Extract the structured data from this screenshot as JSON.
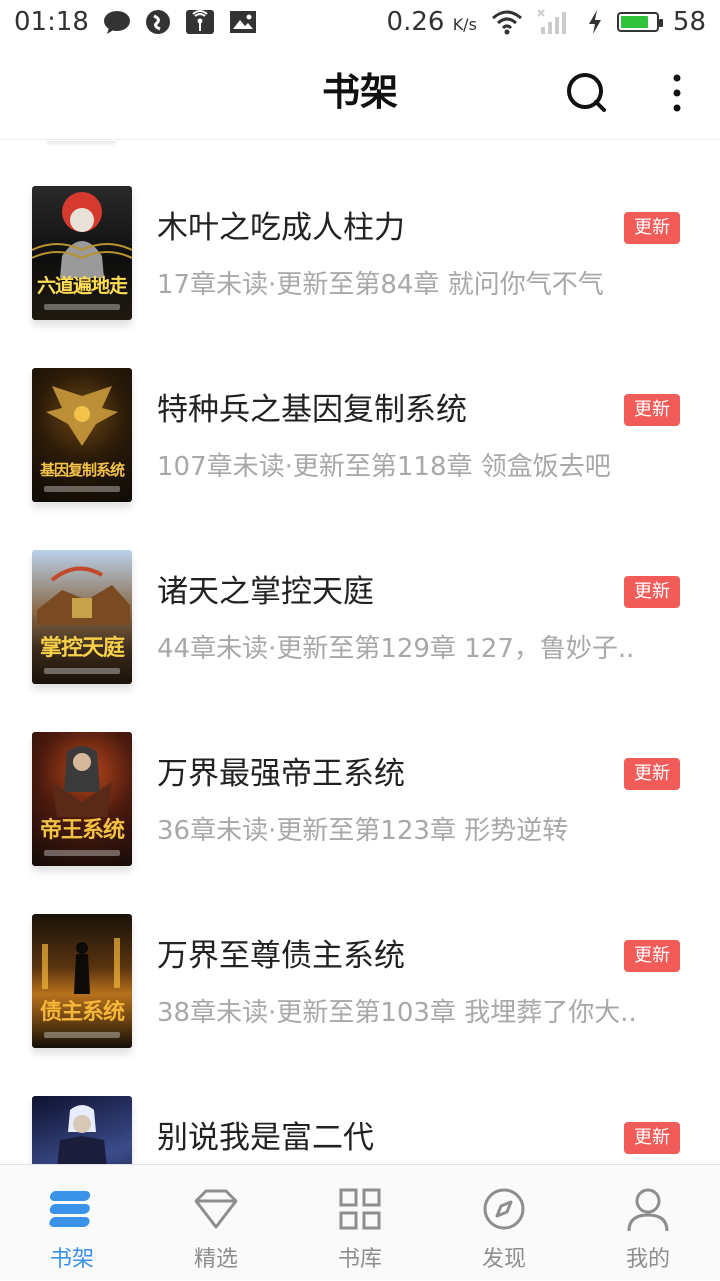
{
  "status_bar": {
    "time": "01:18",
    "net_speed": "0.26",
    "net_speed_unit": "K/s",
    "battery_level": "58"
  },
  "header": {
    "title": "书架",
    "search_icon": "search-icon",
    "more_icon": "more-vertical-icon"
  },
  "books": [
    {
      "title": "木叶之吃成人柱力",
      "meta": "17章未读·更新至第84章 就问你气不气",
      "badge": "更新",
      "cover_text": "六道遍地走",
      "cover_colors": [
        "#1b1b1b",
        "#c9a347",
        "#ffdd55"
      ]
    },
    {
      "title": "特种兵之基因复制系统",
      "meta": "107章未读·更新至第118章 领盒饭去吧",
      "badge": "更新",
      "cover_text": "基因复制系统",
      "cover_colors": [
        "#140f08",
        "#6b4514",
        "#f3c24b"
      ]
    },
    {
      "title": "诸天之掌控天庭",
      "meta": "44章未读·更新至第129章 127，鲁妙子..",
      "badge": "更新",
      "cover_text": "掌控天庭",
      "cover_colors": [
        "#a9c3de",
        "#5a3a1f",
        "#f7d04a"
      ]
    },
    {
      "title": "万界最强帝王系统",
      "meta": "36章未读·更新至第123章 形势逆转",
      "badge": "更新",
      "cover_text": "帝王系统",
      "cover_colors": [
        "#1a0e0a",
        "#8a2b12",
        "#f2c244"
      ]
    },
    {
      "title": "万界至尊债主系统",
      "meta": "38章未读·更新至第103章 我埋葬了你大..",
      "badge": "更新",
      "cover_text": "债主系统",
      "cover_colors": [
        "#0d0a08",
        "#9c5a12",
        "#f5b63a"
      ]
    },
    {
      "title": "别说我是富二代",
      "meta": "",
      "badge": "更新",
      "cover_text": "",
      "cover_colors": [
        "#0e1230",
        "#3b4b8a",
        "#cfd8ff"
      ]
    }
  ],
  "bottom_nav": [
    {
      "label": "书架",
      "icon": "bookshelf-icon",
      "active": true
    },
    {
      "label": "精选",
      "icon": "diamond-icon",
      "active": false
    },
    {
      "label": "书库",
      "icon": "grid-icon",
      "active": false
    },
    {
      "label": "发现",
      "icon": "compass-icon",
      "active": false
    },
    {
      "label": "我的",
      "icon": "user-icon",
      "active": false
    }
  ],
  "colors": {
    "accent": "#3a93e8",
    "badge": "#f15b58",
    "meta_text": "#a8a8a8"
  }
}
